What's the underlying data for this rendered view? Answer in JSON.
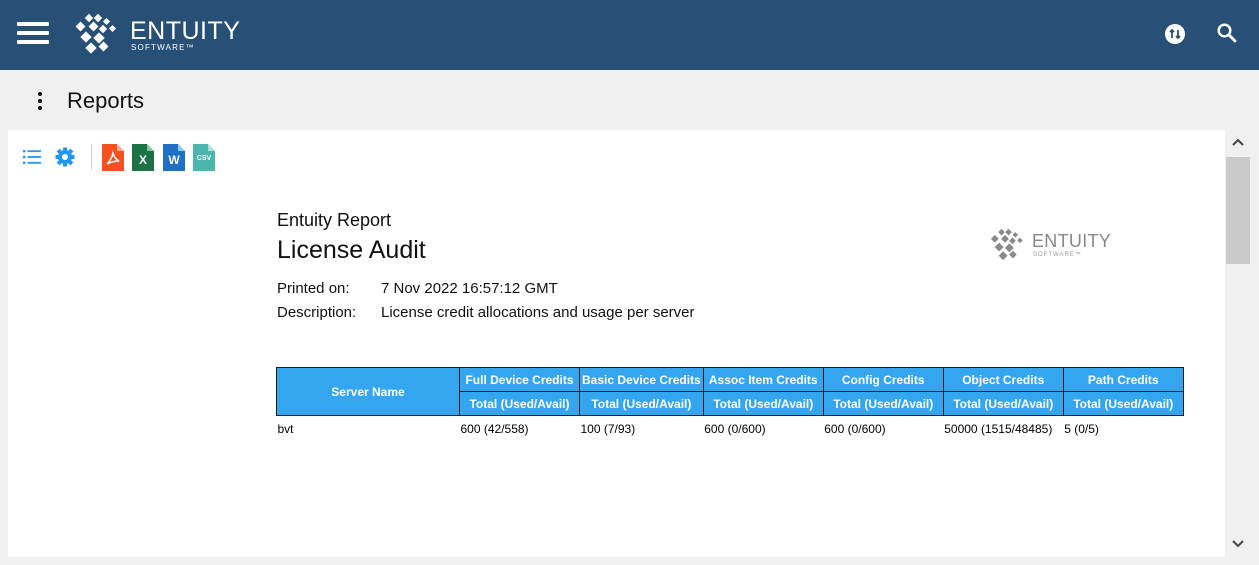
{
  "header": {
    "brand_name": "ENTUITY",
    "brand_sub": "SOFTWARE™"
  },
  "titlebar": {
    "title": "Reports"
  },
  "toolbar": {
    "pdf_label": "",
    "excel_label": "X",
    "word_label": "W",
    "csv_label": "CSV"
  },
  "report": {
    "subtitle": "Entuity Report",
    "title": "License Audit",
    "printed_label": "Printed on:",
    "printed_value": "7 Nov 2022 16:57:12 GMT",
    "description_label": "Description:",
    "description_value": "License credit allocations and usage per server",
    "logo_word": "ENTUITY",
    "logo_sub": "SOFTWARE™"
  },
  "table": {
    "server_header": "Server Name",
    "groups": [
      "Full Device Credits",
      "Basic Device Credits",
      "Assoc Item Credits",
      "Config Credits",
      "Object Credits",
      "Path Credits"
    ],
    "sub_header": "Total (Used/Avail)",
    "rows": [
      {
        "server": "bvt",
        "values": [
          "600 (42/558)",
          "100 (7/93)",
          "600 (0/600)",
          "600 (0/600)",
          "50000 (1515/48485)",
          "5 (0/5)"
        ]
      }
    ]
  },
  "colors": {
    "header_bg": "#284f75",
    "table_header_bg": "#34a6f0",
    "icon_blue": "#2196f3",
    "pdf": "#f4511e",
    "excel": "#1e7145",
    "word": "#1e6fc6",
    "csv": "#4db6ac"
  }
}
